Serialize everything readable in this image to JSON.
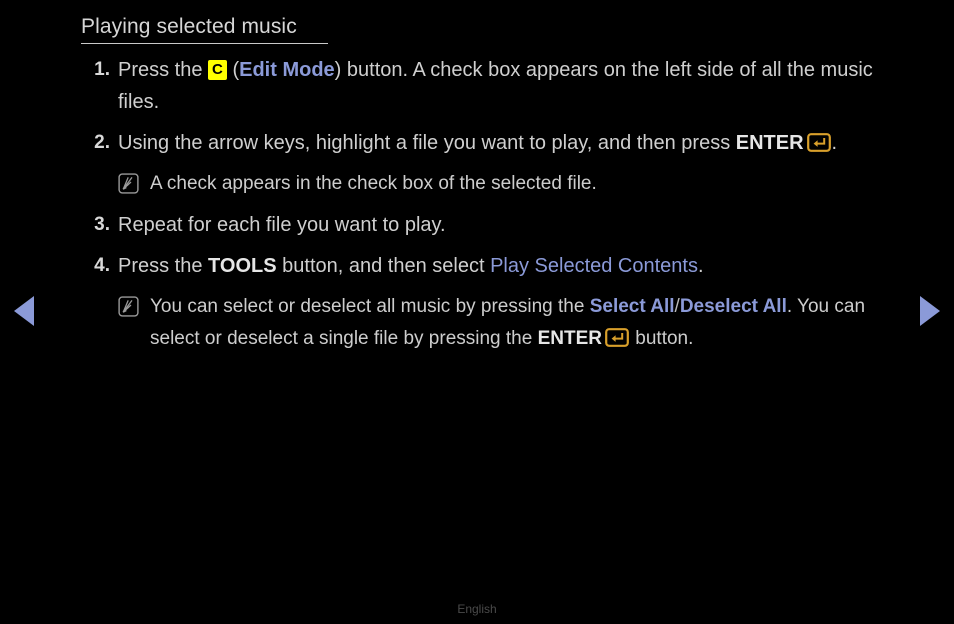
{
  "page": {
    "title": "Playing selected music",
    "background_color": "#000000",
    "text_color": "#cfcfcf",
    "accent_blue": "#8b9ad8",
    "key_yellow": "#ffff00",
    "key_orange": "#d9a02b"
  },
  "steps": [
    {
      "number": "1.",
      "parts": {
        "before_key": "Press the",
        "key_label": "C",
        "open_paren": "(",
        "link": "Edit Mode",
        "after": ") button. A check box appears on the left side of all the music files."
      }
    },
    {
      "number": "2.",
      "parts": {
        "before": "Using the arrow keys, highlight a file you want to play, and then press",
        "enter_label": "ENTER",
        "enter_icon": "enter-key-icon",
        "after": "."
      }
    },
    {
      "number": "3.",
      "parts": {
        "text": "Repeat for each file you want to play."
      }
    },
    {
      "number": "4.",
      "parts": {
        "before": "Press the",
        "tools_label": "TOOLS",
        "middle": "button, and then select",
        "link": "Play Selected Contents",
        "after": "."
      }
    }
  ],
  "notes": [
    {
      "icon": "note-icon",
      "text": "A check appears in the check box of the selected file."
    },
    {
      "icon": "note-icon",
      "segments": {
        "lead": "You can select or deselect all music by pressing the",
        "link_a": "Select All",
        "separator": "/",
        "link_b": "Deselect All",
        "middle": ". You can select or deselect a single file by pressing the",
        "enter_label": "ENTER",
        "enter_icon": "enter-key-icon",
        "tail": "button."
      }
    }
  ],
  "navigation": {
    "prev_label": "previous-page",
    "prev_icon": "triangle-left-icon",
    "next_label": "next-page",
    "next_icon": "triangle-right-icon"
  },
  "footer": {
    "language": "English"
  }
}
